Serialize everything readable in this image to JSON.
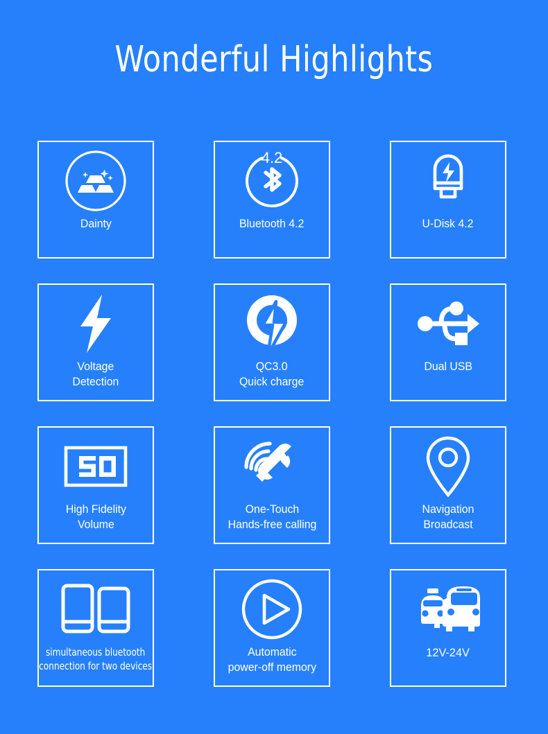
{
  "page": {
    "background_color": "#2680fc",
    "foreground_color": "#ffffff",
    "title": "Wonderful Highlights"
  },
  "grid": {
    "columns": 3,
    "rows": 4,
    "tiles": [
      {
        "id": "dainty",
        "icon": "gold-bars-circle-icon",
        "label_lines": [
          "Dainty"
        ]
      },
      {
        "id": "bluetooth",
        "icon": "bluetooth-circle-icon",
        "icon_badge": "4.2",
        "label_lines": [
          "Bluetooth 4.2"
        ]
      },
      {
        "id": "u-disk",
        "icon": "usb-flash-drive-icon",
        "label_lines": [
          "U-Disk 4.2"
        ]
      },
      {
        "id": "voltage-detection",
        "icon": "lightning-bolt-icon",
        "label_lines": [
          "Voltage",
          "Detection"
        ]
      },
      {
        "id": "quick-charge",
        "icon": "quick-charge-icon",
        "label_lines": [
          "QC3.0",
          "Quick charge"
        ]
      },
      {
        "id": "dual-usb",
        "icon": "usb-trident-icon",
        "label_lines": [
          "Dual USB"
        ]
      },
      {
        "id": "high-fidelity-volume",
        "icon": "volume-display-icon",
        "icon_value": "50",
        "label_lines": [
          "High Fidelity",
          "Volume"
        ]
      },
      {
        "id": "hands-free-calling",
        "icon": "phone-handset-waves-icon",
        "label_lines": [
          "One-Touch",
          "Hands-free calling"
        ]
      },
      {
        "id": "navigation-broadcast",
        "icon": "map-pin-icon",
        "label_lines": [
          "Navigation",
          "Broadcast"
        ]
      },
      {
        "id": "dual-device-bluetooth",
        "icon": "two-phones-icon",
        "label_lines": [
          "simultaneous bluetooth",
          "connection for two devices"
        ]
      },
      {
        "id": "auto-power-off-memory",
        "icon": "play-circle-icon",
        "label_lines": [
          "Automatic",
          "power-off memory"
        ]
      },
      {
        "id": "voltage-range",
        "icon": "taxi-bus-icon",
        "label_lines": [
          "12V-24V"
        ]
      }
    ]
  }
}
